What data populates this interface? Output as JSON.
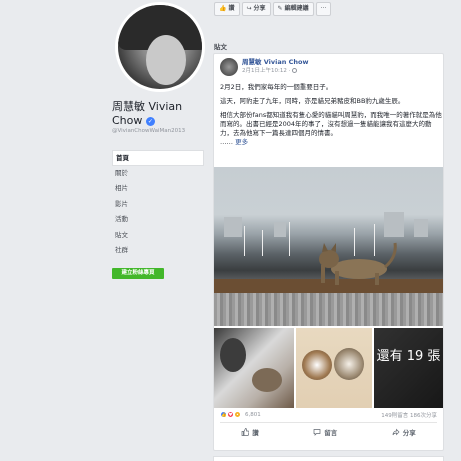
{
  "page": {
    "name": "周慧敏 Vivian Chow",
    "handle": "@VivianChowWaiMan2013"
  },
  "nav": {
    "items": [
      {
        "label": "首頁"
      },
      {
        "label": "關於"
      },
      {
        "label": "相片"
      },
      {
        "label": "影片"
      },
      {
        "label": "活動"
      },
      {
        "label": "貼文"
      },
      {
        "label": "社群"
      }
    ],
    "cta_label": "建立粉絲專頁"
  },
  "toolbar": {
    "like_label": "讚",
    "share_label": "分享",
    "edit_label": "編輯建議",
    "more_label": "···"
  },
  "section": {
    "title": "貼文"
  },
  "post": {
    "author": "周慧敏 Vivian Chow",
    "time": "2月1日上午10:12 · ",
    "paragraphs": [
      "2月2日，我們家每年的一個重要日子。",
      "這天，阿豹走了九年，同時，亦是貓兄弟豬皮和BB豹九歲生辰。",
      "相信大部份fans都知道我有隻心愛的貓貓叫周慧豹，而我唯一的著作就是為他而寫的。出書已經是2004年的事了，沒有想過一隻貓能讓我有這麼大的動力，去為他寫下一篇長達四個月的情書。"
    ],
    "ellipsis": "……",
    "see_more": "更多",
    "more_photos": "還有 19 張",
    "reaction_count": "6,801",
    "stats": "149則留言 186次分享"
  },
  "actions": {
    "like": "讚",
    "comment": "留言",
    "share": "分享"
  },
  "colors": {
    "link": "#365899",
    "green": "#42b72a",
    "like_blue": "#4080ff",
    "love_red": "#f33e58"
  }
}
